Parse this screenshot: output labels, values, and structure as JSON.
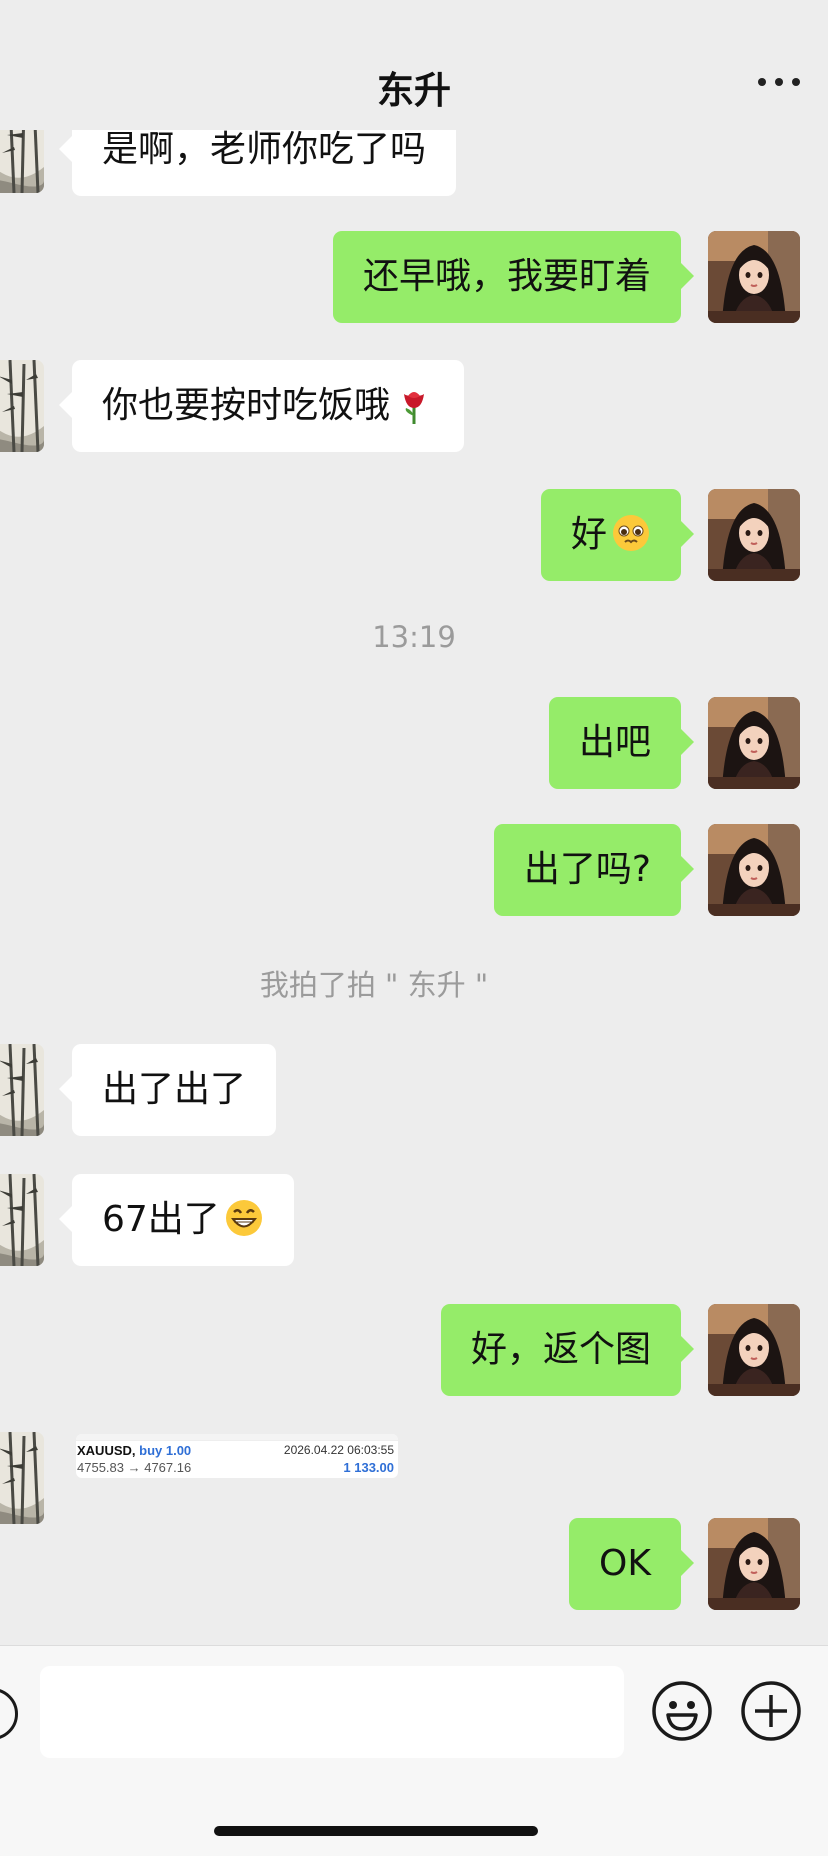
{
  "header": {
    "title": "东升"
  },
  "messages": [
    {
      "side": "left",
      "text": "是啊，老师你吃了吗"
    },
    {
      "side": "right",
      "text": "还早哦，我要盯着"
    },
    {
      "side": "left",
      "text": "你也要按时吃饭哦",
      "emoji": "rose-emoji"
    },
    {
      "side": "right",
      "text": "好",
      "emoji": "pleading-face-emoji"
    },
    {
      "side": "right",
      "text": "出吧"
    },
    {
      "side": "right",
      "text": "出了吗?"
    },
    {
      "side": "left",
      "text": "出了出了"
    },
    {
      "side": "left",
      "text": "67出了",
      "emoji": "grinning-face-emoji"
    },
    {
      "side": "right",
      "text": "好，返个图"
    },
    {
      "side": "right",
      "text": "OK"
    }
  ],
  "timestamp": "13:19",
  "system_message": "我拍了拍 \" 东升 \"",
  "trade_card": {
    "symbol": "XAUUSD,",
    "side_label": "buy 1.00",
    "datetime": "2026.04.22 06:03:55",
    "prices": "4755.83 → 4767.16",
    "profit": "1 133.00"
  },
  "input": {
    "value": ""
  },
  "colors": {
    "background": "#ededed",
    "sent_bubble": "#95ec69",
    "received_bubble": "#ffffff",
    "profit_blue": "#2f6fd6"
  }
}
